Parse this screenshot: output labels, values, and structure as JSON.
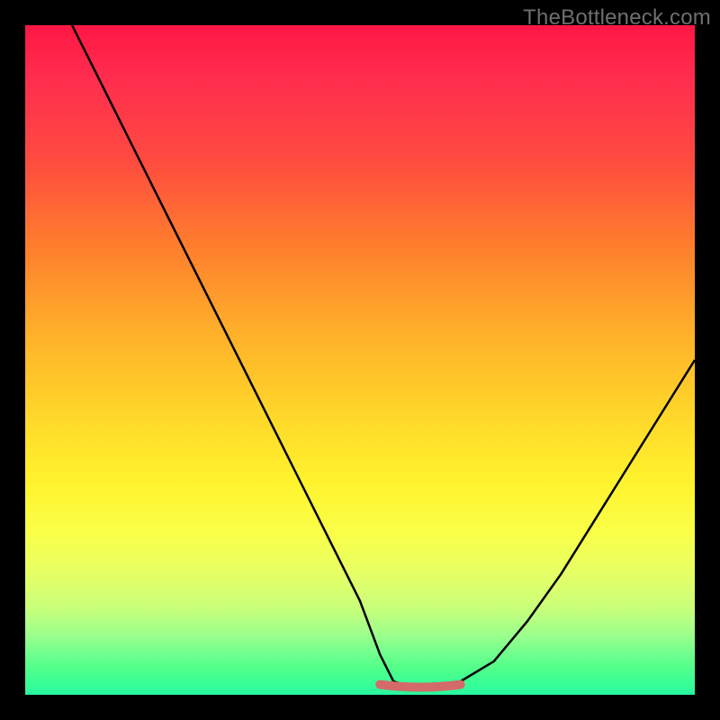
{
  "watermark": "TheBottleneck.com",
  "colors": {
    "curve_stroke": "#000000",
    "highlight_stroke": "#d46a6a",
    "background_black": "#000000"
  },
  "chart_data": {
    "type": "line",
    "title": "",
    "xlabel": "",
    "ylabel": "",
    "xlim": [
      0,
      100
    ],
    "ylim": [
      0,
      100
    ],
    "series": [
      {
        "name": "bottleneck-curve",
        "x": [
          7,
          10,
          15,
          20,
          25,
          30,
          35,
          40,
          45,
          50,
          53,
          55,
          58,
          60,
          63,
          65,
          70,
          75,
          80,
          85,
          90,
          95,
          100
        ],
        "y": [
          100,
          94,
          84,
          74,
          64,
          54,
          44,
          34,
          24,
          14,
          6,
          2,
          1,
          1,
          1,
          2,
          5,
          11,
          18,
          26,
          34,
          42,
          50
        ]
      }
    ],
    "annotations": [
      {
        "name": "optimal-range",
        "x_start": 53,
        "x_end": 65,
        "y": 1
      }
    ]
  }
}
